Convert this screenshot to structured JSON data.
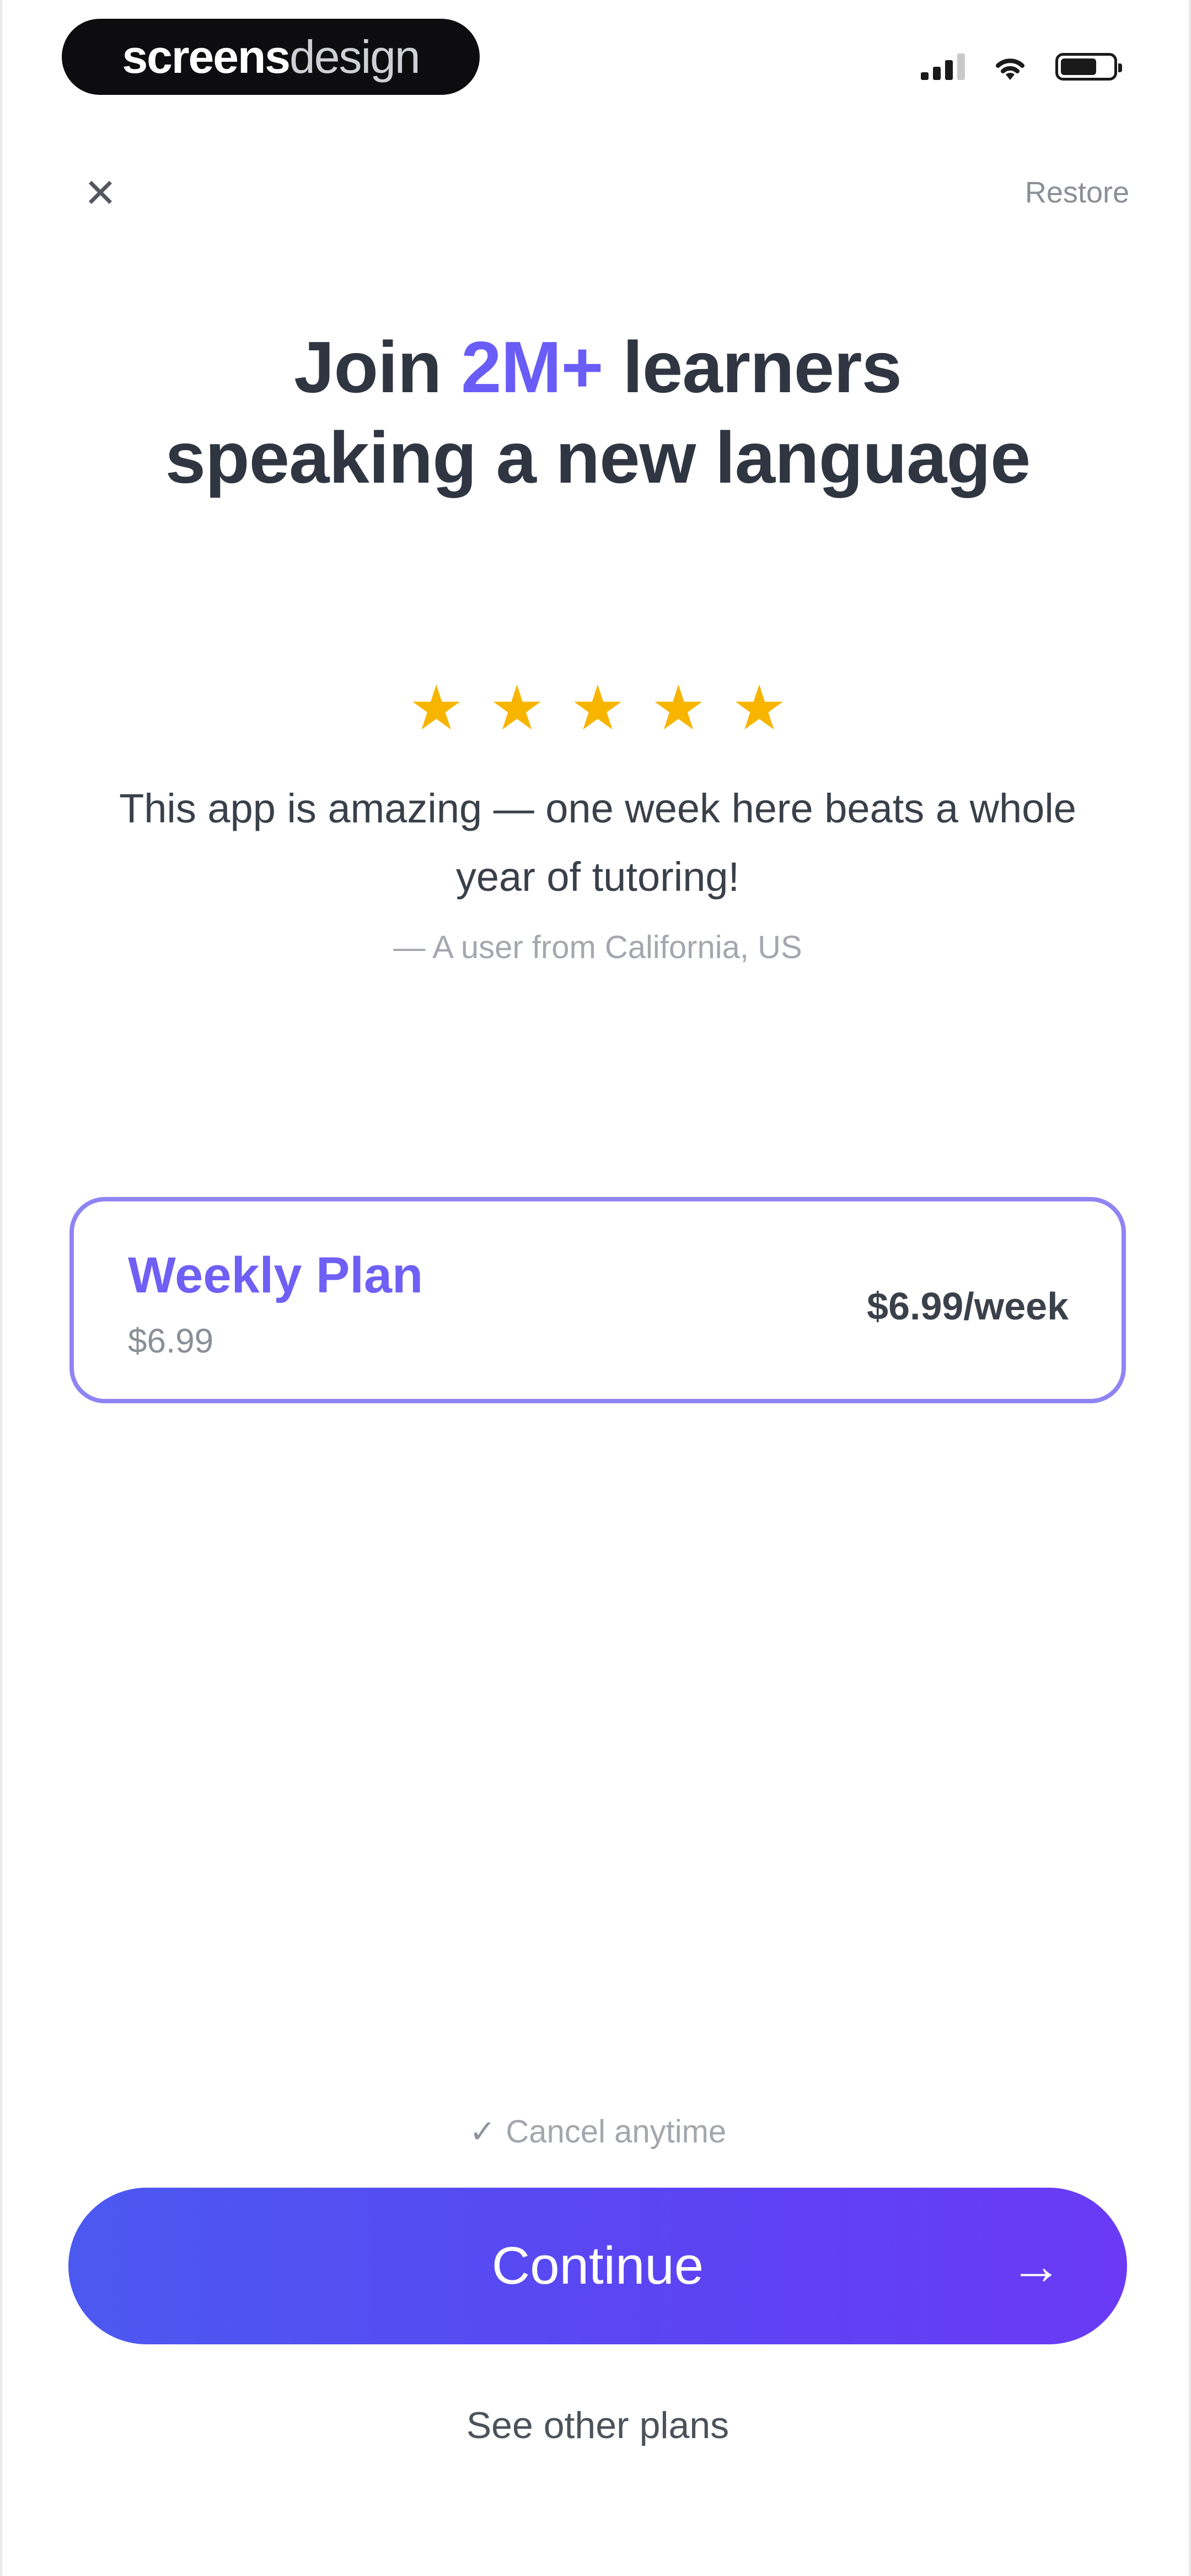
{
  "status_bar": {
    "brand_bold": "screens",
    "brand_light": "design"
  },
  "nav": {
    "close_glyph": "✕",
    "restore_label": "Restore"
  },
  "headline": {
    "pre": "Join ",
    "accent": "2M+",
    "post": " learners",
    "line2": "speaking a new language",
    "accent_color": "#6a5cf6"
  },
  "review": {
    "rating": 5,
    "star_glyph": "★",
    "star_color": "#f7b500",
    "quote": "This app is amazing — one week here beats a whole year of tutoring!",
    "attribution": "— A user from California, US"
  },
  "plan": {
    "name": "Weekly Plan",
    "sub_price": "$6.99",
    "price_label": "$6.99/week",
    "selected": true,
    "accent_color": "#6f5ff5"
  },
  "footer": {
    "check_glyph": "✓",
    "cancel_note": "Cancel anytime",
    "continue_label": "Continue",
    "arrow_glyph": "→",
    "other_plans_label": "See other plans"
  },
  "icons": [
    "close-icon",
    "signal-icon",
    "wifi-icon",
    "battery-icon",
    "star-icon",
    "check-icon",
    "arrow-right-icon"
  ]
}
